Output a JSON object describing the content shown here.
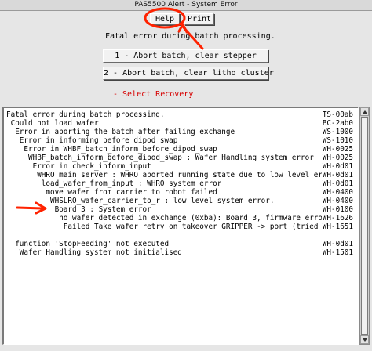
{
  "window": {
    "title": "PAS5500 Alert - System Error"
  },
  "toolbar": {
    "help_label": "Help",
    "print_label": "Print"
  },
  "main": {
    "message": "Fatal error during batch processing.",
    "actions": [
      {
        "label": "1 - Abort batch, clear stepper"
      },
      {
        "label": "2 - Abort batch, clear litho cluster"
      }
    ],
    "recovery_label": "- Select Recovery"
  },
  "log": {
    "rows": [
      {
        "indent": 0,
        "msg": "Fatal error during batch processing.",
        "code": "TS-00ab"
      },
      {
        "indent": 1,
        "msg": "Could not load wafer",
        "code": "BC-2ab0"
      },
      {
        "indent": 2,
        "msg": "Error in aborting the batch after failing exchange",
        "code": "WS-1000"
      },
      {
        "indent": 3,
        "msg": "Error in informing before dipod swap",
        "code": "WS-1010"
      },
      {
        "indent": 4,
        "msg": "Error in WHBF_batch_inform_before_dipod_swap",
        "code": "WH-0025"
      },
      {
        "indent": 5,
        "msg": "WHBF_batch_inform_before_dipod_swap : Wafer Handling system error",
        "code": "WH-0025"
      },
      {
        "indent": 6,
        "msg": "Error in check_inform_input",
        "code": "WH-0d01"
      },
      {
        "indent": 7,
        "msg": "WHRO_main_server : WHRO aborted running state due to low level error",
        "code": "WH-0d01"
      },
      {
        "indent": 8,
        "msg": "load_wafer_from_input : WHRO system error",
        "code": "WH-0d01"
      },
      {
        "indent": 9,
        "msg": "move wafer from carrier to robot failed",
        "code": "WH-0400"
      },
      {
        "indent": 10,
        "msg": "WHSLRO_wafer_carrier_to_r : low level system error.",
        "code": "WH-0400"
      },
      {
        "indent": 11,
        "msg": "Board 3 : System error",
        "code": "WH-0100"
      },
      {
        "indent": 12,
        "msg": "no wafer detected in exchange (0xba): Board 3, firmware error",
        "code": "WH-1626"
      },
      {
        "indent": 13,
        "msg": "Failed Take wafer retry on takeover GRIPPER -> port (tried",
        "code": "WH-1651"
      },
      {
        "indent": 0,
        "msg": "",
        "code": ""
      },
      {
        "indent": 2,
        "msg": "function 'StopFeeding' not executed",
        "code": "WH-0d01"
      },
      {
        "indent": 3,
        "msg": "Wafer Handling system not initialised",
        "code": "WH-1501"
      }
    ]
  },
  "annotations": {
    "marker_color": "#ff2200"
  },
  "colors": {
    "accent_red": "#d60000",
    "window_bg": "#e6e6e6",
    "log_bg": "#ffffff"
  },
  "icons": {
    "scroll_up": "triangle-up",
    "scroll_down": "triangle-down"
  }
}
